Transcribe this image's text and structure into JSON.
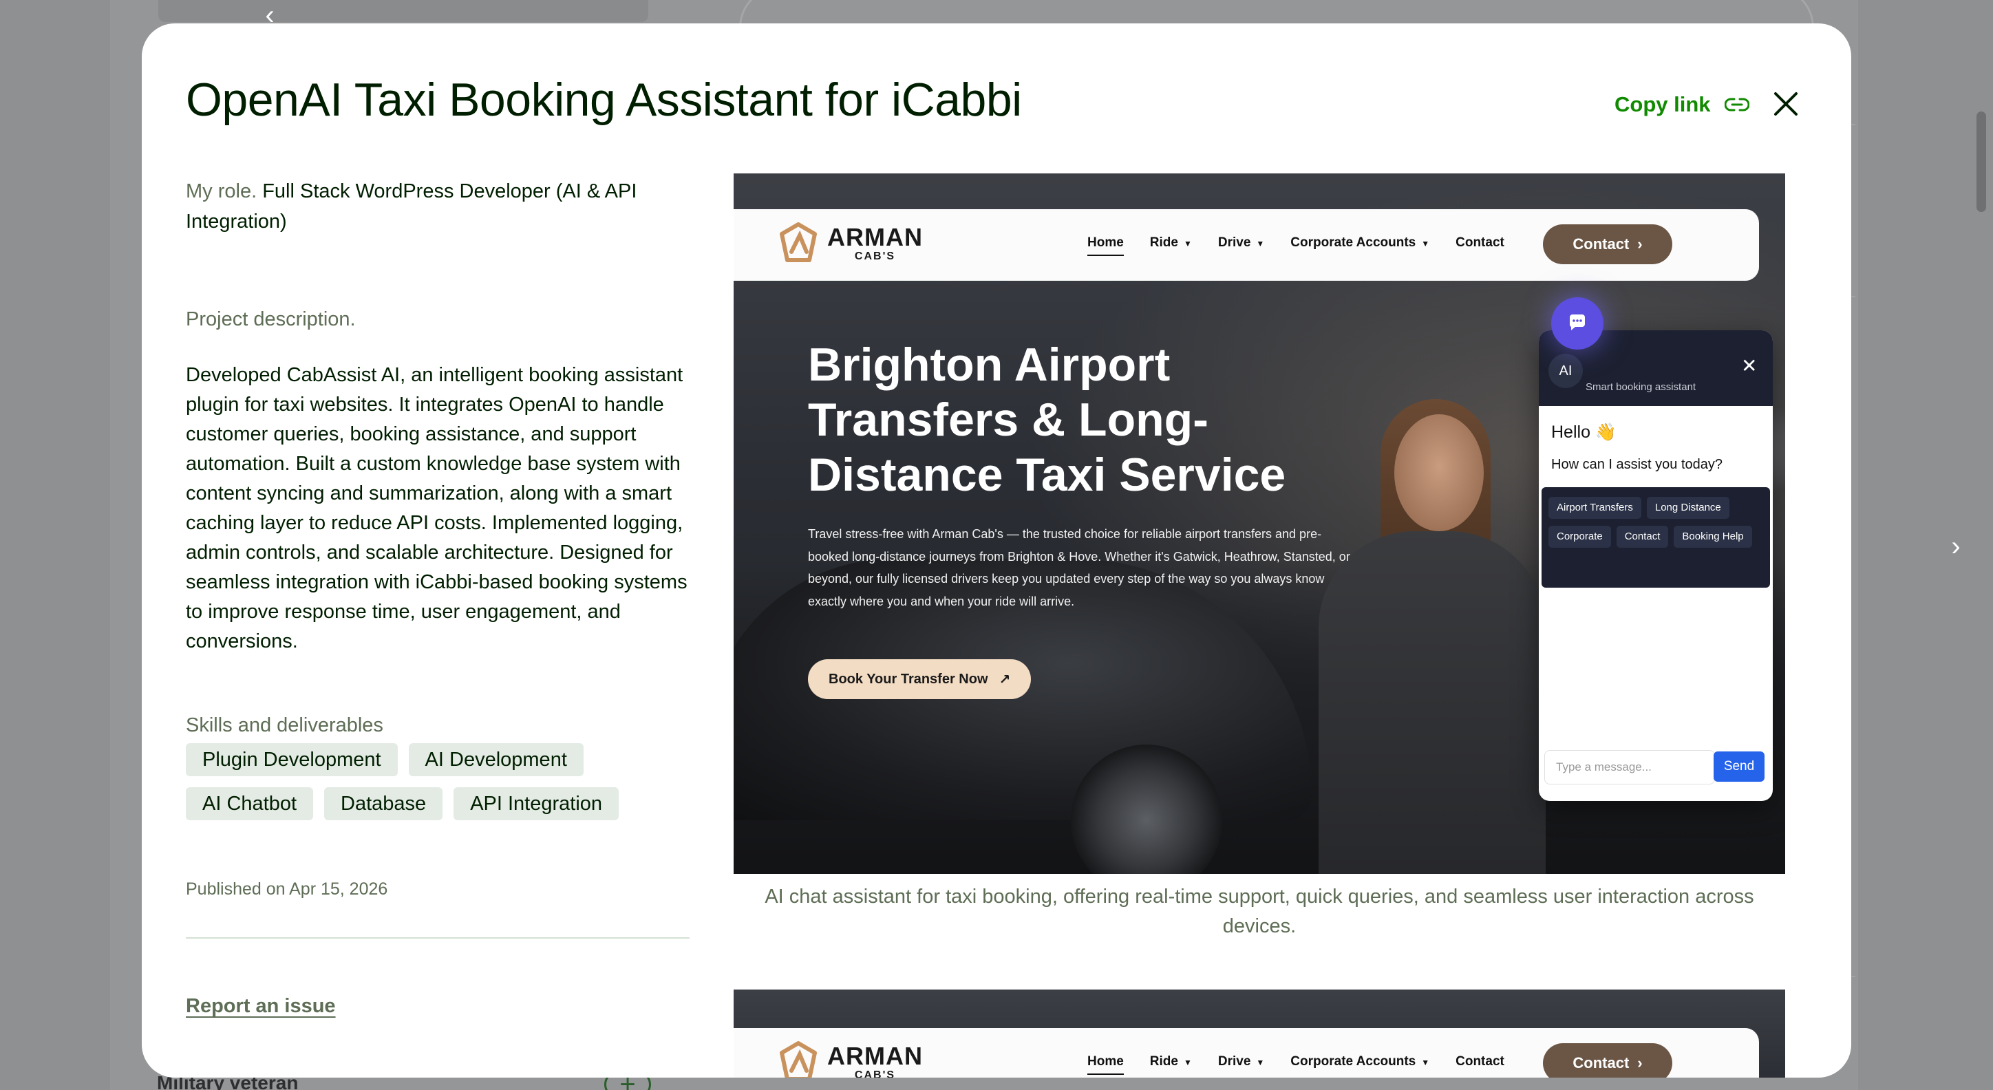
{
  "background": {
    "veteran_label": "Military veteran",
    "plus_symbol": "+",
    "prev_arrow": "‹",
    "next_arrow": "›"
  },
  "modal": {
    "title": "OpenAI Taxi Booking Assistant for iCabbi",
    "copy_link": "Copy link",
    "role_label": "My role.",
    "role_value": " Full Stack WordPress Developer (AI & API Integration)",
    "description_label": "Project description.",
    "description": "Developed CabAssist AI, an intelligent booking assistant plugin for taxi websites. It integrates OpenAI to handle customer queries, booking assistance, and support automation. Built a custom knowledge base system with content syncing and summarization, along with a smart caching layer to reduce API costs. Implemented logging, admin controls, and scalable architecture. Designed for seamless integration with iCabbi-based booking systems to improve response time, user engagement, and conversions.",
    "skills_label": "Skills and deliverables",
    "skills": [
      "Plugin Development",
      "AI Development",
      "AI Chatbot",
      "Database",
      "API Integration"
    ],
    "published": "Published on Apr 15, 2026",
    "report": "Report an issue",
    "caption": "AI chat assistant for taxi booking, offering real-time support, quick queries, and seamless user interaction across devices."
  },
  "site": {
    "logo_name": "ARMAN",
    "logo_sub": "CAB'S",
    "nav": [
      "Home",
      "Ride",
      "Drive",
      "Corporate Accounts",
      "Contact"
    ],
    "nav_dropdowns": [
      "Ride",
      "Drive",
      "Corporate Accounts"
    ],
    "contact_button": "Contact",
    "hero_title": "Brighton Airport Transfers & Long-Distance Taxi Service",
    "hero_body": "Travel stress-free with Arman Cab's — the trusted choice for reliable airport transfers and pre-booked long-distance journeys from Brighton & Hove. Whether it's Gatwick, Heathrow, Stansted, or beyond, our fully licensed drivers keep you updated every step of the way so you always know exactly where you and when your ride will arrive.",
    "hero_cta": "Book Your Transfer Now",
    "accent_brown": "#6b5646",
    "accent_cream": "#f3dcc4"
  },
  "chat": {
    "avatar": "AI",
    "subtitle": "Smart booking assistant",
    "close": "✕",
    "hello": "Hello 👋",
    "ask": "How can I assist you today?",
    "quick_replies": [
      "Airport Transfers",
      "Long Distance",
      "Corporate",
      "Contact",
      "Booking Help"
    ],
    "input_placeholder": "Type a message...",
    "send": "Send",
    "accent": "#2563eb"
  },
  "colors": {
    "brand_green": "#108a00",
    "text_dark": "#001e00",
    "text_muted": "#5e6d55",
    "chip_bg": "#e4ebe4"
  }
}
